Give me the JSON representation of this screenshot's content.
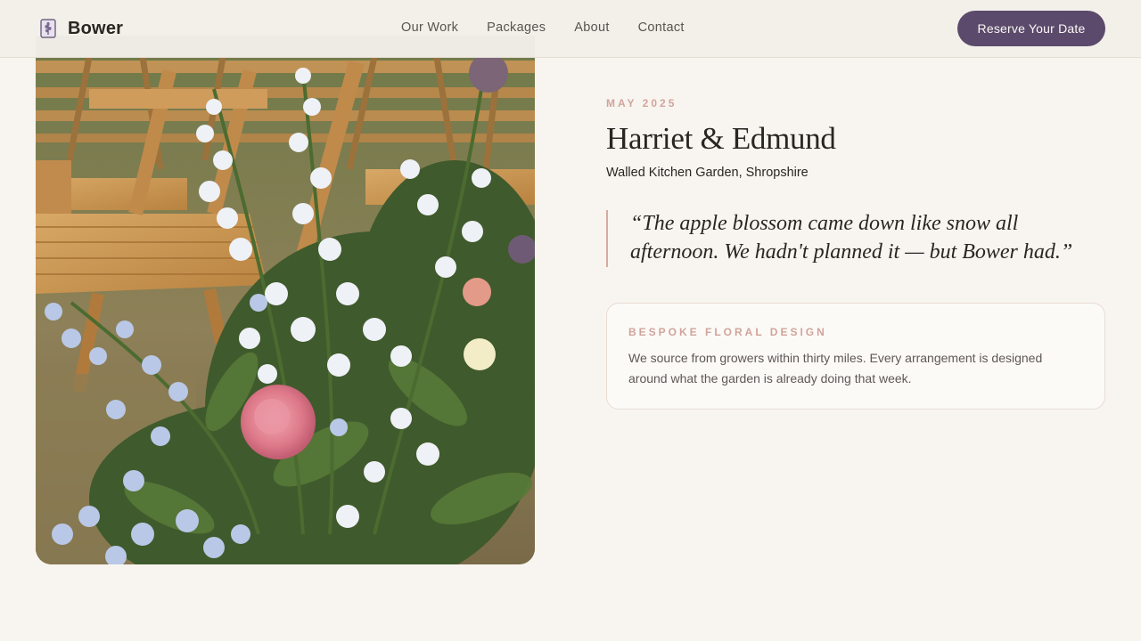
{
  "brand": {
    "name": "Bower",
    "icon": "lavender-sprig-icon"
  },
  "nav": {
    "items": [
      {
        "label": "Our Work"
      },
      {
        "label": "Packages"
      },
      {
        "label": "About"
      },
      {
        "label": "Contact"
      }
    ],
    "cta_label": "Reserve Your Date"
  },
  "story": {
    "date": "MAY 2025",
    "couple": "Harriet & Edmund",
    "venue": "Walled Kitchen Garden, Shropshire",
    "quote": "“The apple blossom came down like snow all afternoon. We hadn't planned it — but Bower had.”"
  },
  "feature_card": {
    "title": "BESPOKE FLORAL DESIGN",
    "body": "We source from growers within thirty miles. Every arrangement is designed around what the garden is already doing that week."
  },
  "colors": {
    "background": "#f8f5f0",
    "accent_plum": "#5b4a6b",
    "accent_blush": "#d1a49b",
    "text_dark": "#2b2522"
  }
}
